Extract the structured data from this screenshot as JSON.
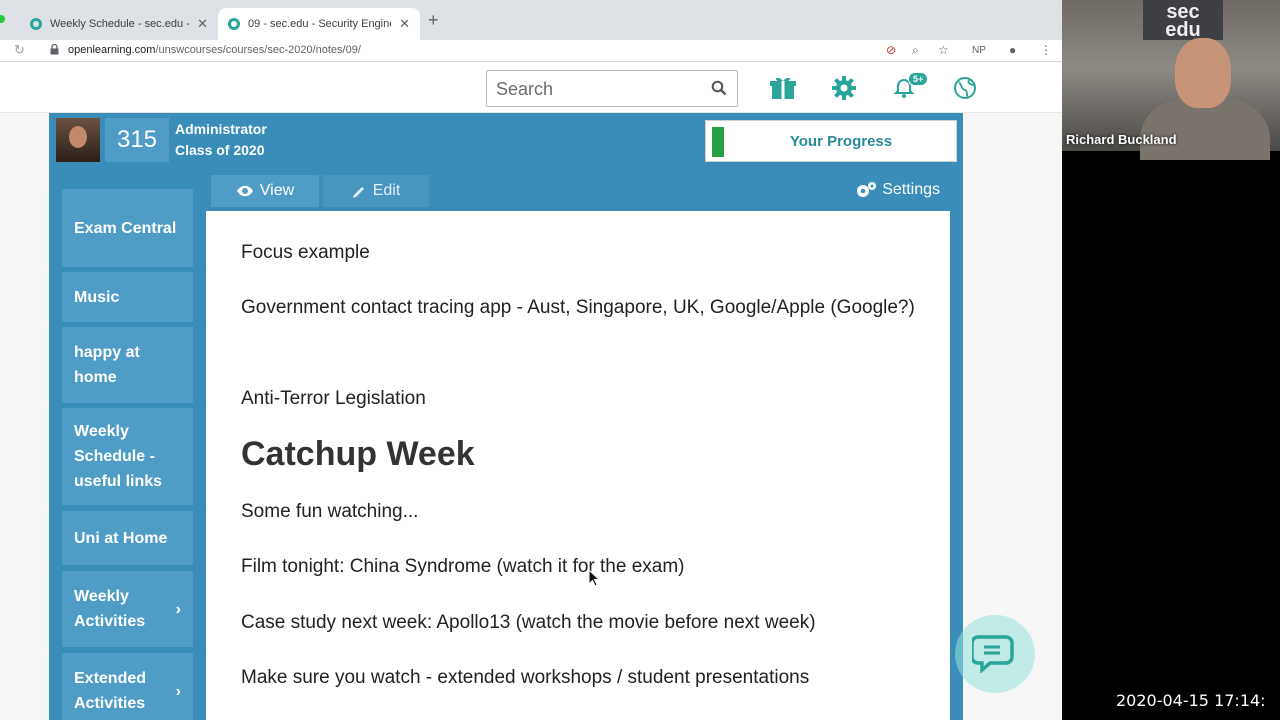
{
  "browser": {
    "tabs": [
      {
        "title": "Weekly Schedule - sec.edu - Se"
      },
      {
        "title": "09 - sec.edu - Security Enginee"
      }
    ],
    "new_tab_glyph": "+",
    "url_host": "openlearning.com",
    "url_path": "/unswcourses/courses/sec-2020/notes/09/",
    "profile_initials": "NP"
  },
  "header": {
    "search_placeholder": "Search",
    "notifications_badge": "5+"
  },
  "course_bar": {
    "points": "315",
    "role": "Administrator",
    "class": "Class of 2020",
    "progress_label": "Your Progress",
    "progress_color": "#27a046"
  },
  "sidebar": {
    "items": [
      {
        "label": "Exam Central"
      },
      {
        "label": "Music"
      },
      {
        "label": "happy at home"
      },
      {
        "label": "Weekly Schedule - useful links"
      },
      {
        "label": "Uni at Home"
      },
      {
        "label": "Weekly Activities"
      },
      {
        "label": "Extended Activities"
      }
    ]
  },
  "content": {
    "view_label": "View",
    "edit_label": "Edit",
    "settings_label": "Settings",
    "lines": [
      "Focus example",
      "Government contact tracing app - Aust, Singapore, UK, Google/Apple (Google?)",
      "Anti-Terror Legislation",
      "Some fun watching...",
      "Film tonight: China Syndrome (watch it for the exam)",
      "Case study next week: Apollo13 (watch the movie before next week)",
      "Make sure you watch - extended workshops / student presentations"
    ],
    "heading": "Catchup Week"
  },
  "video": {
    "logo_line1": "sec",
    "logo_line2": "edu",
    "speaker": "Richard Buckland",
    "timestamp": "2020-04-15  17:14:"
  },
  "colors": {
    "brand_blue": "#3a8db8",
    "item_blue": "#4f9dc6",
    "teal": "#2aa59a"
  }
}
